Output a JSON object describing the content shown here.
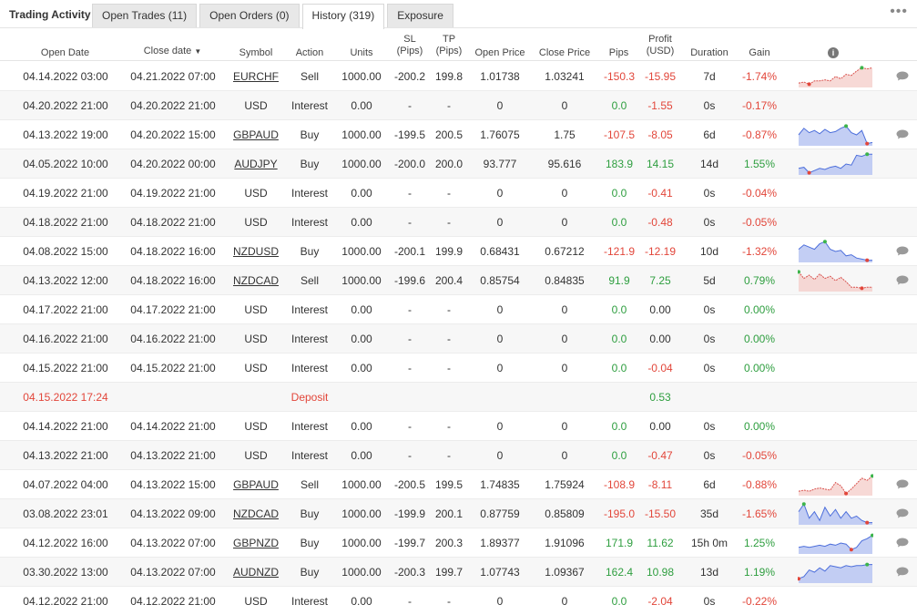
{
  "header": {
    "title": "Trading Activity",
    "tabs": [
      "Open Trades (11)",
      "Open Orders (0)",
      "History (319)",
      "Exposure"
    ],
    "active_tab": 2,
    "more_icon": "more-dots-icon"
  },
  "columns": {
    "open_date": "Open Date",
    "close_date": "Close date",
    "symbol": "Symbol",
    "action": "Action",
    "units": "Units",
    "sl": [
      "SL",
      "(Pips)"
    ],
    "tp": [
      "TP",
      "(Pips)"
    ],
    "open_price": "Open Price",
    "close_price": "Close Price",
    "pips": "Pips",
    "profit": [
      "Profit",
      "(USD)"
    ],
    "duration": "Duration",
    "gain": "Gain",
    "info_icon": "info-icon"
  },
  "colors": {
    "positive": "#2e9e3f",
    "negative": "#e2463a",
    "deposit": "#e2463a",
    "spark_red": "#d9534f",
    "spark_blue": "#4c6edb"
  },
  "rows": [
    {
      "open": "04.14.2022 03:00",
      "close": "04.21.2022 07:00",
      "symbol": "EURCHF",
      "link": true,
      "action": "Sell",
      "units": "1000.00",
      "sl": "-200.2",
      "tp": "199.8",
      "open_price": "1.01738",
      "close_price": "1.03241",
      "pips": "-150.3",
      "profit": "-15.95",
      "duration": "7d",
      "gain": "-1.74%",
      "spark": "red",
      "spark_values": [
        0.2,
        0.25,
        0.15,
        0.3,
        0.3,
        0.35,
        0.3,
        0.5,
        0.4,
        0.6,
        0.55,
        0.75,
        0.9,
        0.85,
        0.9
      ],
      "comment": true
    },
    {
      "open": "04.20.2022 21:00",
      "close": "04.20.2022 21:00",
      "symbol": "USD",
      "link": false,
      "action": "Interest",
      "units": "0.00",
      "sl": "-",
      "tp": "-",
      "open_price": "0",
      "close_price": "0",
      "pips": "0.0",
      "profit": "-1.55",
      "duration": "0s",
      "gain": "-0.17%",
      "spark": null,
      "comment": false
    },
    {
      "open": "04.13.2022 19:00",
      "close": "04.20.2022 15:00",
      "symbol": "GBPAUD",
      "link": true,
      "action": "Buy",
      "units": "1000.00",
      "sl": "-199.5",
      "tp": "200.5",
      "open_price": "1.76075",
      "close_price": "1.75",
      "pips": "-107.5",
      "profit": "-8.05",
      "duration": "6d",
      "gain": "-0.87%",
      "spark": "blue",
      "spark_values": [
        0.5,
        0.8,
        0.6,
        0.7,
        0.55,
        0.75,
        0.6,
        0.65,
        0.8,
        0.9,
        0.6,
        0.5,
        0.7,
        0.1,
        0.15
      ],
      "comment": true
    },
    {
      "open": "04.05.2022 10:00",
      "close": "04.20.2022 00:00",
      "symbol": "AUDJPY",
      "link": true,
      "action": "Buy",
      "units": "1000.00",
      "sl": "-200.0",
      "tp": "200.0",
      "open_price": "93.777",
      "close_price": "95.616",
      "pips": "183.9",
      "profit": "14.15",
      "duration": "14d",
      "gain": "1.55%",
      "spark": "blue",
      "spark_values": [
        0.3,
        0.35,
        0.1,
        0.2,
        0.3,
        0.25,
        0.35,
        0.4,
        0.3,
        0.5,
        0.45,
        0.9,
        0.85,
        0.95,
        0.95
      ],
      "comment": false
    },
    {
      "open": "04.19.2022 21:00",
      "close": "04.19.2022 21:00",
      "symbol": "USD",
      "link": false,
      "action": "Interest",
      "units": "0.00",
      "sl": "-",
      "tp": "-",
      "open_price": "0",
      "close_price": "0",
      "pips": "0.0",
      "profit": "-0.41",
      "duration": "0s",
      "gain": "-0.04%",
      "spark": null,
      "comment": false
    },
    {
      "open": "04.18.2022 21:00",
      "close": "04.18.2022 21:00",
      "symbol": "USD",
      "link": false,
      "action": "Interest",
      "units": "0.00",
      "sl": "-",
      "tp": "-",
      "open_price": "0",
      "close_price": "0",
      "pips": "0.0",
      "profit": "-0.48",
      "duration": "0s",
      "gain": "-0.05%",
      "spark": null,
      "comment": false
    },
    {
      "open": "04.08.2022 15:00",
      "close": "04.18.2022 16:00",
      "symbol": "NZDUSD",
      "link": true,
      "action": "Buy",
      "units": "1000.00",
      "sl": "-200.1",
      "tp": "199.9",
      "open_price": "0.68431",
      "close_price": "0.67212",
      "pips": "-121.9",
      "profit": "-12.19",
      "duration": "10d",
      "gain": "-1.32%",
      "spark": "blue",
      "spark_values": [
        0.6,
        0.8,
        0.7,
        0.6,
        0.85,
        0.95,
        0.6,
        0.5,
        0.55,
        0.3,
        0.35,
        0.2,
        0.15,
        0.1,
        0.1
      ],
      "comment": true
    },
    {
      "open": "04.13.2022 12:00",
      "close": "04.18.2022 16:00",
      "symbol": "NZDCAD",
      "link": true,
      "action": "Sell",
      "units": "1000.00",
      "sl": "-199.6",
      "tp": "200.4",
      "open_price": "0.85754",
      "close_price": "0.84835",
      "pips": "91.9",
      "profit": "7.25",
      "duration": "5d",
      "gain": "0.79%",
      "spark": "red",
      "spark_values": [
        0.9,
        0.6,
        0.75,
        0.55,
        0.8,
        0.6,
        0.7,
        0.5,
        0.65,
        0.45,
        0.2,
        0.2,
        0.15,
        0.2,
        0.2
      ],
      "comment": true
    },
    {
      "open": "04.17.2022 21:00",
      "close": "04.17.2022 21:00",
      "symbol": "USD",
      "link": false,
      "action": "Interest",
      "units": "0.00",
      "sl": "-",
      "tp": "-",
      "open_price": "0",
      "close_price": "0",
      "pips": "0.0",
      "profit": "0.00",
      "duration": "0s",
      "gain": "0.00%",
      "spark": null,
      "comment": false
    },
    {
      "open": "04.16.2022 21:00",
      "close": "04.16.2022 21:00",
      "symbol": "USD",
      "link": false,
      "action": "Interest",
      "units": "0.00",
      "sl": "-",
      "tp": "-",
      "open_price": "0",
      "close_price": "0",
      "pips": "0.0",
      "profit": "0.00",
      "duration": "0s",
      "gain": "0.00%",
      "spark": null,
      "comment": false
    },
    {
      "open": "04.15.2022 21:00",
      "close": "04.15.2022 21:00",
      "symbol": "USD",
      "link": false,
      "action": "Interest",
      "units": "0.00",
      "sl": "-",
      "tp": "-",
      "open_price": "0",
      "close_price": "0",
      "pips": "0.0",
      "profit": "-0.04",
      "duration": "0s",
      "gain": "0.00%",
      "spark": null,
      "comment": false
    },
    {
      "open": "04.15.2022 17:24",
      "close": "",
      "symbol": "",
      "link": false,
      "action": "Deposit",
      "units": "",
      "sl": "",
      "tp": "",
      "open_price": "",
      "close_price": "",
      "pips": "",
      "profit": "0.53",
      "duration": "",
      "gain": "",
      "spark": null,
      "comment": false,
      "deposit": true
    },
    {
      "open": "04.14.2022 21:00",
      "close": "04.14.2022 21:00",
      "symbol": "USD",
      "link": false,
      "action": "Interest",
      "units": "0.00",
      "sl": "-",
      "tp": "-",
      "open_price": "0",
      "close_price": "0",
      "pips": "0.0",
      "profit": "0.00",
      "duration": "0s",
      "gain": "0.00%",
      "spark": null,
      "comment": false
    },
    {
      "open": "04.13.2022 21:00",
      "close": "04.13.2022 21:00",
      "symbol": "USD",
      "link": false,
      "action": "Interest",
      "units": "0.00",
      "sl": "-",
      "tp": "-",
      "open_price": "0",
      "close_price": "0",
      "pips": "0.0",
      "profit": "-0.47",
      "duration": "0s",
      "gain": "-0.05%",
      "spark": null,
      "comment": false
    },
    {
      "open": "04.07.2022 04:00",
      "close": "04.13.2022 15:00",
      "symbol": "GBPAUD",
      "link": true,
      "action": "Sell",
      "units": "1000.00",
      "sl": "-200.5",
      "tp": "199.5",
      "open_price": "1.74835",
      "close_price": "1.75924",
      "pips": "-108.9",
      "profit": "-8.11",
      "duration": "6d",
      "gain": "-0.88%",
      "spark": "red",
      "spark_values": [
        0.2,
        0.25,
        0.2,
        0.3,
        0.35,
        0.3,
        0.25,
        0.6,
        0.45,
        0.1,
        0.3,
        0.55,
        0.8,
        0.7,
        0.9
      ],
      "comment": true
    },
    {
      "open": "03.08.2022 23:01",
      "close": "04.13.2022 09:00",
      "symbol": "NZDCAD",
      "link": true,
      "action": "Buy",
      "units": "1000.00",
      "sl": "-199.9",
      "tp": "200.1",
      "open_price": "0.87759",
      "close_price": "0.85809",
      "pips": "-195.0",
      "profit": "-15.50",
      "duration": "35d",
      "gain": "-1.65%",
      "spark": "blue",
      "spark_values": [
        0.6,
        0.95,
        0.3,
        0.6,
        0.2,
        0.8,
        0.4,
        0.7,
        0.3,
        0.6,
        0.3,
        0.4,
        0.2,
        0.1,
        0.1
      ],
      "comment": true
    },
    {
      "open": "04.12.2022 16:00",
      "close": "04.13.2022 07:00",
      "symbol": "GBPNZD",
      "link": true,
      "action": "Buy",
      "units": "1000.00",
      "sl": "-199.7",
      "tp": "200.3",
      "open_price": "1.89377",
      "close_price": "1.91096",
      "pips": "171.9",
      "profit": "11.62",
      "duration": "15h 0m",
      "gain": "1.25%",
      "spark": "blue",
      "spark_values": [
        0.3,
        0.35,
        0.3,
        0.35,
        0.4,
        0.35,
        0.45,
        0.4,
        0.5,
        0.45,
        0.2,
        0.3,
        0.6,
        0.7,
        0.85
      ],
      "comment": true
    },
    {
      "open": "03.30.2022 13:00",
      "close": "04.13.2022 07:00",
      "symbol": "AUDNZD",
      "link": true,
      "action": "Buy",
      "units": "1000.00",
      "sl": "-200.3",
      "tp": "199.7",
      "open_price": "1.07743",
      "close_price": "1.09367",
      "pips": "162.4",
      "profit": "10.98",
      "duration": "13d",
      "gain": "1.19%",
      "spark": "blue",
      "spark_values": [
        0.2,
        0.3,
        0.6,
        0.5,
        0.7,
        0.55,
        0.8,
        0.75,
        0.7,
        0.8,
        0.75,
        0.8,
        0.8,
        0.85,
        0.85
      ],
      "comment": true
    },
    {
      "open": "04.12.2022 21:00",
      "close": "04.12.2022 21:00",
      "symbol": "USD",
      "link": false,
      "action": "Interest",
      "units": "0.00",
      "sl": "-",
      "tp": "-",
      "open_price": "0",
      "close_price": "0",
      "pips": "0.0",
      "profit": "-2.04",
      "duration": "0s",
      "gain": "-0.22%",
      "spark": null,
      "comment": false
    }
  ]
}
